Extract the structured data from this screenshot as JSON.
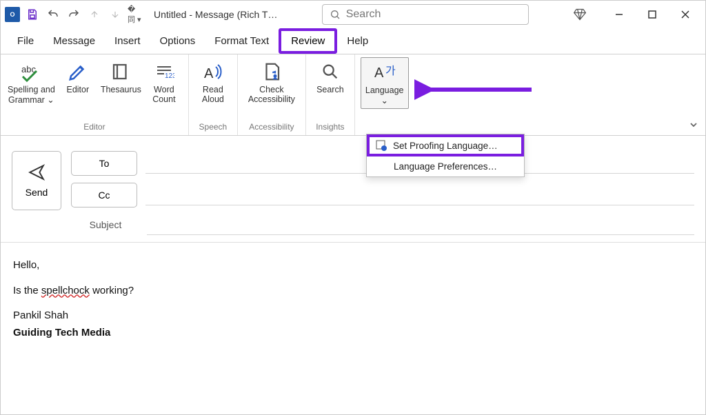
{
  "title": "Untitled  -  Message (Rich T…",
  "search_placeholder": "Search",
  "menu": {
    "file": "File",
    "message": "Message",
    "insert": "Insert",
    "options": "Options",
    "format_text": "Format Text",
    "review": "Review",
    "help": "Help"
  },
  "ribbon": {
    "spelling_grammar": "Spelling and\nGrammar ⌄",
    "editor": "Editor",
    "thesaurus": "Thesaurus",
    "word_count": "Word\nCount",
    "read_aloud": "Read\nAloud",
    "check_accessibility": "Check\nAccessibility",
    "search": "Search",
    "language": "Language\n⌄",
    "group_editor": "Editor",
    "group_speech": "Speech",
    "group_accessibility": "Accessibility",
    "group_insights": "Insights"
  },
  "lang_popup": {
    "set_proofing": "Set Proofing Language…",
    "prefs": "Language Preferences…"
  },
  "compose": {
    "send": "Send",
    "to": "To",
    "cc": "Cc",
    "subject": "Subject"
  },
  "body": {
    "l1": "Hello,",
    "l2a": "Is the ",
    "l2err": "spellchock",
    "l2b": " working?",
    "l3": "Pankil Shah",
    "l4": "Guiding Tech Media"
  }
}
